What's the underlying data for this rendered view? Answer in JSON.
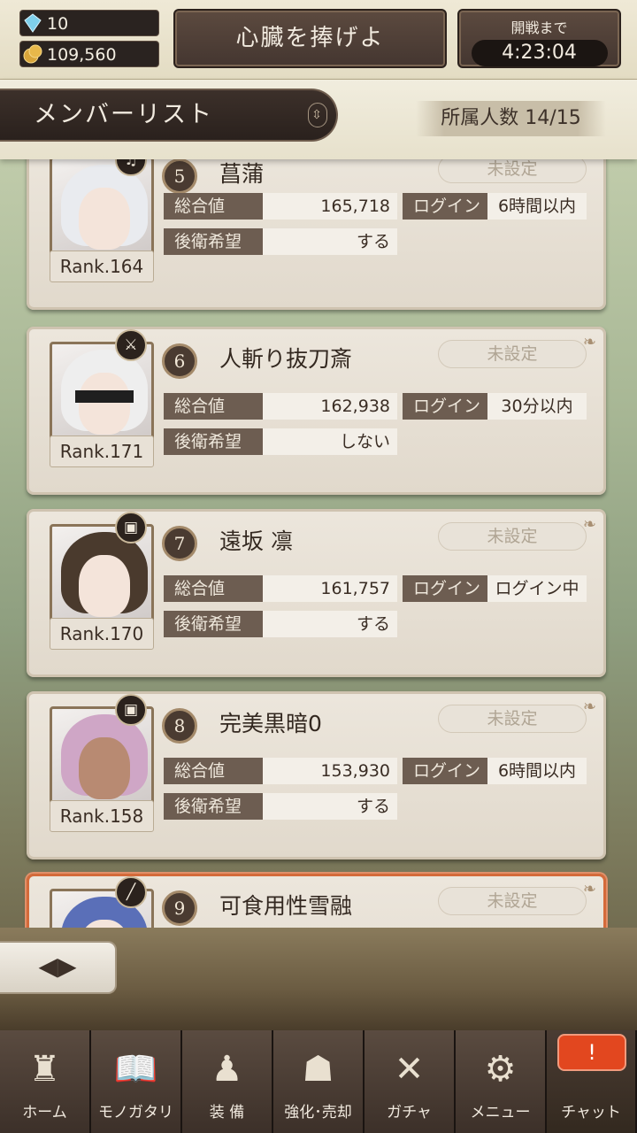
{
  "top": {
    "gems": "10",
    "coins": "109,560",
    "event_title": "心臓を捧げよ",
    "timer_label": "開戦まで",
    "timer_value": "4:23:04"
  },
  "header": {
    "title": "メンバーリスト",
    "sort_glyph": "⇳",
    "member_count": "所属人数 14/15"
  },
  "members": [
    {
      "num": "5",
      "name": "菖蒲",
      "rank": "Rank.164",
      "status": "未設定",
      "total_label": "総合値",
      "total": "165,718",
      "login_label": "ログイン",
      "login": "6時間以内",
      "rear_label": "後衛希望",
      "rear": "する",
      "class_icon": "harp-icon",
      "class_glyph": "♫"
    },
    {
      "num": "6",
      "name": "人斬り抜刀斎",
      "rank": "Rank.171",
      "status": "未設定",
      "total_label": "総合値",
      "total": "162,938",
      "login_label": "ログイン",
      "login": "30分以内",
      "rear_label": "後衛希望",
      "rear": "しない",
      "class_icon": "sword-icon",
      "class_glyph": "⚔"
    },
    {
      "num": "7",
      "name": "遠坂 凛",
      "rank": "Rank.170",
      "status": "未設定",
      "total_label": "総合値",
      "total": "161,757",
      "login_label": "ログイン",
      "login": "ログイン中",
      "rear_label": "後衛希望",
      "rear": "する",
      "class_icon": "tome-icon",
      "class_glyph": "▣"
    },
    {
      "num": "8",
      "name": "完美黒暗0",
      "rank": "Rank.158",
      "status": "未設定",
      "total_label": "総合値",
      "total": "153,930",
      "login_label": "ログイン",
      "login": "6時間以内",
      "rear_label": "後衛希望",
      "rear": "する",
      "class_icon": "tome-icon",
      "class_glyph": "▣"
    },
    {
      "num": "9",
      "name": "可食用性雪融",
      "rank": "",
      "status": "未設定",
      "total_label": "",
      "total": "",
      "login_label": "",
      "login": "",
      "rear_label": "",
      "rear": "",
      "class_icon": "spear-icon",
      "class_glyph": "╱"
    }
  ],
  "back_glyph": "◀▶",
  "nav": [
    {
      "label": "ホーム",
      "icon": "castle-icon",
      "glyph": "♜"
    },
    {
      "label": "モノガタリ",
      "icon": "book-icon",
      "glyph": "📖"
    },
    {
      "label": "装 備",
      "icon": "puppet-icon",
      "glyph": "♟"
    },
    {
      "label": "強化･売却",
      "icon": "mask-icon",
      "glyph": "☗"
    },
    {
      "label": "ガチャ",
      "icon": "swords-icon",
      "glyph": "✕"
    },
    {
      "label": "メニュー",
      "icon": "gears-icon",
      "glyph": "⚙"
    },
    {
      "label": "チャット",
      "icon": "chat-alert-icon",
      "glyph": "!"
    }
  ],
  "colors": {
    "card_bg": "#ece6dc",
    "stat_label_bg": "#6d5d51",
    "highlight_border": "#d46a3a",
    "nav_bg": "#2b221d",
    "chat_alert": "#e2471f"
  }
}
